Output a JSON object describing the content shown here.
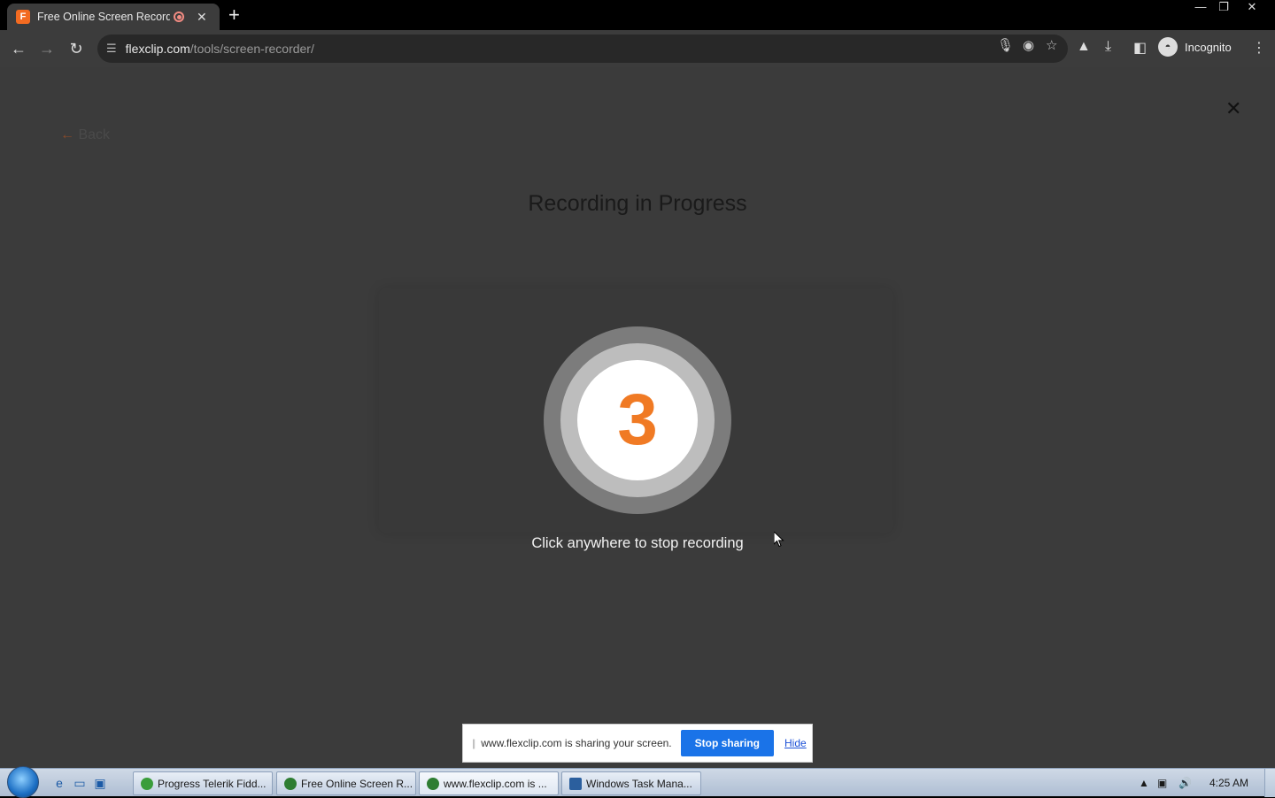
{
  "browser": {
    "tab_title": "Free Online Screen Recorde",
    "favicon_letter": "F",
    "url_host": "flexclip.com",
    "url_path": "/tools/screen-recorder/",
    "profile_label": "Incognito"
  },
  "page": {
    "back_label": "Back",
    "heading": "Recording in Progress",
    "countdown": "3",
    "hint": "Click anywhere to stop recording"
  },
  "sharebar": {
    "message": "www.flexclip.com is sharing your screen.",
    "stop_label": "Stop sharing",
    "hide_label": "Hide"
  },
  "taskbar": {
    "items": [
      {
        "label": "Progress Telerik Fidd...",
        "icon_color": "#3a9d3a"
      },
      {
        "label": "Free Online Screen R...",
        "icon_color": "#2e7d32"
      },
      {
        "label": "www.flexclip.com is ...",
        "icon_color": "#2e7d32"
      },
      {
        "label": "Windows Task Mana...",
        "icon_color": "#2b5f9e"
      }
    ],
    "clock": "4:25 AM"
  },
  "colors": {
    "accent_orange": "#f07a24",
    "share_blue": "#1a73e8"
  }
}
